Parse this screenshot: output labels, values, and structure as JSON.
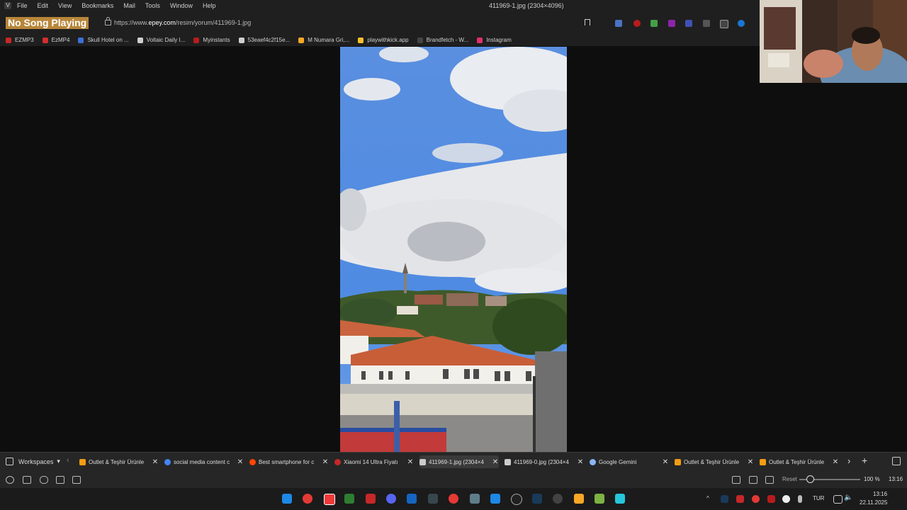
{
  "menu": {
    "items": [
      "File",
      "Edit",
      "View",
      "Bookmarks",
      "Mail",
      "Tools",
      "Window",
      "Help"
    ],
    "window_title": "411969-1.jpg (2304×4096)"
  },
  "address": {
    "song_label": "No Song Playing",
    "url_prefix": "https://www.",
    "url_domain": "epey.com",
    "url_path": "/resim/yorum/411969-1.jpg"
  },
  "bookmarks": [
    {
      "label": "EZMP3",
      "color": "#c62828"
    },
    {
      "label": "EzMP4",
      "color": "#d32f2f"
    },
    {
      "label": "Skull Hotel on ...",
      "color": "#3d6fd6"
    },
    {
      "label": "Voltaic Daily I...",
      "color": "#cfcfcf"
    },
    {
      "label": "Myinstants",
      "color": "#b71c1c"
    },
    {
      "label": "53eaef4c2f15e...",
      "color": "#cfcfcf"
    },
    {
      "label": "M Numara Gri,...",
      "color": "#f9a825"
    },
    {
      "label": "playwithkick.app",
      "color": "#fbc02d"
    },
    {
      "label": "Brandfetch - W...",
      "color": "#444444"
    },
    {
      "label": "Instagram",
      "color": "#e1306c"
    }
  ],
  "tabs": {
    "workspaces_label": "Workspaces",
    "items": [
      {
        "label": "Outlet & Teşhir Ürünle",
        "color": "#f39c12",
        "active": false
      },
      {
        "label": "social media content c",
        "color": "#4285f4",
        "active": false
      },
      {
        "label": "Best smartphone for c",
        "color": "#ff4500",
        "active": false
      },
      {
        "label": "Xiaomi 14 Ultra Fiyatı",
        "color": "#c62828",
        "active": false
      },
      {
        "label": "411969-1.jpg (2304×4",
        "color": "#cccccc",
        "active": true
      },
      {
        "label": "411969-0.jpg (2304×4",
        "color": "#cccccc",
        "active": false
      },
      {
        "label": "Google Gemini",
        "color": "#8ab4f8",
        "active": false
      },
      {
        "label": "Outlet & Teşhir Ürünle",
        "color": "#f39c12",
        "active": false
      },
      {
        "label": "Outlet & Teşhir Ürünle",
        "color": "#f39c12",
        "active": false
      }
    ]
  },
  "status": {
    "reset_label": "Reset",
    "zoom_label": "100 %",
    "zoom_fraction": 0.17,
    "clock": "13:16"
  },
  "taskbar": {
    "language": "TUR",
    "time": "13:16",
    "date": "22.11.2025"
  }
}
